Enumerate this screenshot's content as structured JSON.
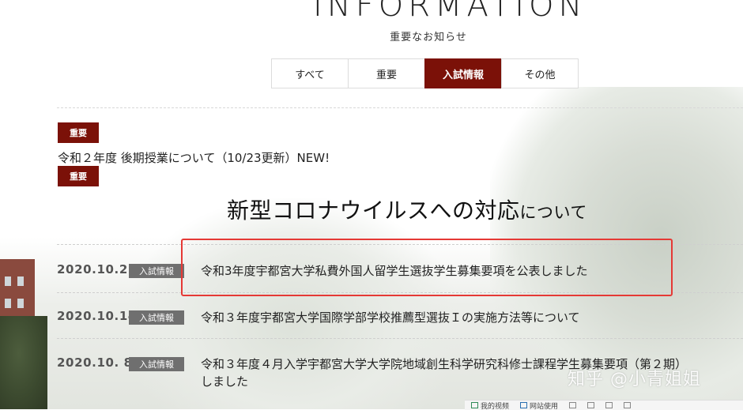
{
  "header": {
    "title": "INFORMATION",
    "subtitle": "重要なお知らせ"
  },
  "tabs": [
    {
      "label": "すべて",
      "active": false
    },
    {
      "label": "重要",
      "active": false
    },
    {
      "label": "入試情報",
      "active": true
    },
    {
      "label": "その他",
      "active": false
    }
  ],
  "notices": [
    {
      "badge": "重要",
      "text": "令和２年度 後期授業について（10/23更新）NEW!"
    },
    {
      "badge": "重要"
    }
  ],
  "section": {
    "title_main": "新型コロナウイルスへの対応",
    "title_suffix": "について"
  },
  "news": [
    {
      "date": "2020.10.22",
      "category": "入試情報",
      "title": "令和3年度宇都宮大学私費外国人留学生選抜学生募集要項を公表しました"
    },
    {
      "date": "2020.10.14",
      "category": "入試情報",
      "title": "令和３年度宇都宮大学国際学部学校推薦型選抜Ｉの実施方法等について"
    },
    {
      "date": "2020.10. 8",
      "category": "入試情報",
      "title": "令和３年度４月入学宇都宮大学大学院地域創生科学研究科修士課程学生募集要項（第２期）",
      "title_line2": "しました"
    }
  ],
  "watermark": "知乎 @小青姐姐",
  "bottom_bar": {
    "item1": "我的视频",
    "item2": "网站使用"
  },
  "colors": {
    "accent": "#7b1108",
    "category_badge": "#6f6f6f",
    "highlight_box": "#e53935"
  }
}
